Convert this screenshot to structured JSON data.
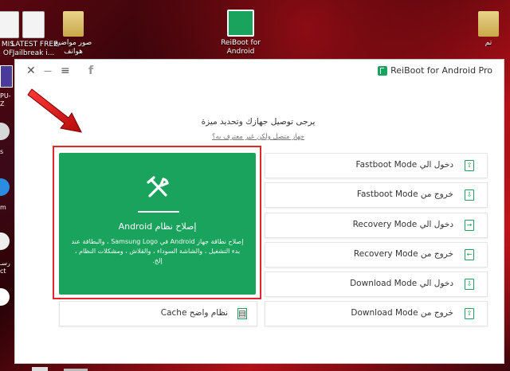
{
  "desktop": {
    "icons": [
      {
        "label": "MIS\nOF",
        "kind": "doc"
      },
      {
        "label": "LATEST FREE\nJailbreak i...",
        "kind": "doc"
      },
      {
        "label": "صور مواضيع\nهواتف",
        "kind": "folder"
      },
      {
        "label": "ReiBoot for\nAndroid",
        "kind": "app"
      },
      {
        "label": "تم",
        "kind": "folder"
      }
    ],
    "left_edge_labels": [
      "PU-Z",
      "s",
      "m",
      "رسـ",
      "ct"
    ]
  },
  "window": {
    "title_controls": {
      "close": "✕",
      "minimize": "—",
      "menu": "≡",
      "facebook": "f"
    },
    "brand": "ReiBoot for Android Pro",
    "subtitle": "يرجى توصيل جهازك وتحديد ميزة",
    "link": "جهاز متصل ولكن غير معترف به؟",
    "repair": {
      "title": "إصلاح نظام Android",
      "description": "إصلاح نطاقة جهاز Android في Samsung Logo ، والبطاقة عند بدء التشغيل ، والشاشة السوداء ، والقلاش ، ومشكلات النظام ، إلخ."
    },
    "cache_button": "نظام واضح Cache",
    "mode_buttons": [
      {
        "label": "دخول الي Fastboot Mode",
        "icon": "enter-fastboot-icon"
      },
      {
        "label": "خروج من Fastboot Mode",
        "icon": "exit-fastboot-icon"
      },
      {
        "label": "دخول الي Recovery Mode",
        "icon": "enter-recovery-icon"
      },
      {
        "label": "خروج من Recovery Mode",
        "icon": "exit-recovery-icon"
      },
      {
        "label": "دخول الي Download Mode",
        "icon": "enter-download-icon"
      },
      {
        "label": "خروج من Download Mode",
        "icon": "exit-download-icon"
      }
    ]
  },
  "colors": {
    "accent": "#1aa35c",
    "highlight": "#e2262b"
  }
}
